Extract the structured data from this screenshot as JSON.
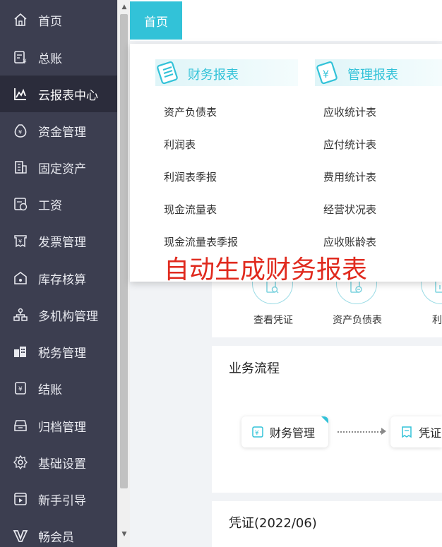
{
  "sidebar": {
    "items": [
      {
        "label": "首页",
        "icon": "home-icon"
      },
      {
        "label": "总账",
        "icon": "ledger-icon"
      },
      {
        "label": "云报表中心",
        "icon": "chart-line-icon",
        "active": true
      },
      {
        "label": "资金管理",
        "icon": "money-bag-icon"
      },
      {
        "label": "固定资产",
        "icon": "building-icon"
      },
      {
        "label": "工资",
        "icon": "salary-icon"
      },
      {
        "label": "发票管理",
        "icon": "invoice-icon"
      },
      {
        "label": "库存核算",
        "icon": "warehouse-icon"
      },
      {
        "label": "多机构管理",
        "icon": "org-tree-icon"
      },
      {
        "label": "税务管理",
        "icon": "tax-icon"
      },
      {
        "label": "结账",
        "icon": "checkout-icon"
      },
      {
        "label": "归档管理",
        "icon": "archive-icon"
      },
      {
        "label": "基础设置",
        "icon": "gear-icon"
      },
      {
        "label": "新手引导",
        "icon": "video-guide-icon"
      },
      {
        "label": "畅会员",
        "icon": "vip-icon"
      }
    ]
  },
  "tabs": {
    "home": "首页"
  },
  "dropdown": {
    "financial": {
      "title": "财务报表",
      "items": [
        "资产负债表",
        "利润表",
        "利润表季报",
        "现金流量表",
        "现金流量表季报"
      ]
    },
    "management": {
      "title": "管理报表",
      "items": [
        "应收统计表",
        "应付统计表",
        "费用统计表",
        "经营状况表",
        "应收账龄表"
      ]
    },
    "promo": "自动生成财务报表"
  },
  "shortcuts": {
    "items": [
      "查看凭证",
      "资产负债表",
      "利润"
    ]
  },
  "process": {
    "title": "业务流程",
    "steps": [
      "财务管理",
      "凭证"
    ]
  },
  "voucher": {
    "title": "凭证(2022/06)"
  },
  "colors": {
    "accent": "#32c2d8",
    "sidebar_bg": "#3c3e50",
    "sidebar_active": "#2b2c3b",
    "promo_red": "#e02a1e"
  }
}
